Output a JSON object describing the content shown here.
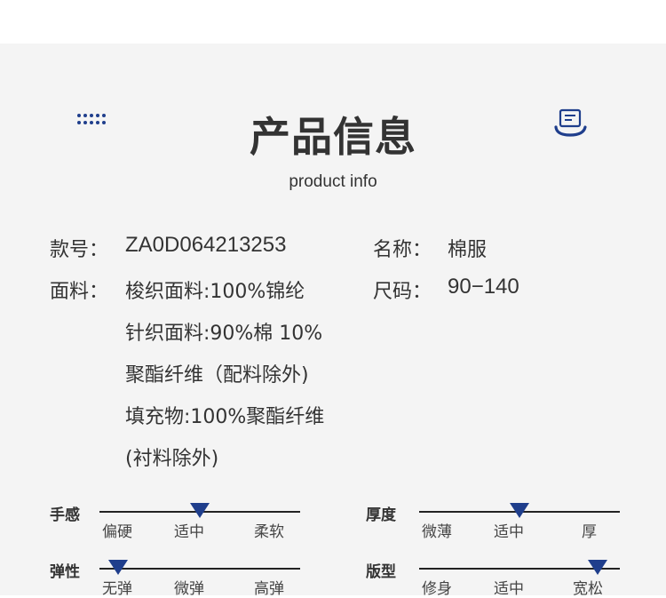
{
  "header": {
    "title": "产品信息",
    "subtitle": "product info",
    "left_icon": "grid-dots-icon",
    "right_icon": "message-icon"
  },
  "colors": {
    "accent": "#1f3e8c",
    "panel_bg": "#f4f4f4",
    "text": "#333333"
  },
  "info": {
    "style_no_label": "款号：",
    "style_no_value": "ZA0D064213253",
    "name_label": "名称：",
    "name_value": "棉服",
    "fabric_label": "面料：",
    "fabric_lines": [
      "梭织面料:100%锦纶",
      "针织面料:90%棉 10%",
      "聚酯纤维（配料除外)",
      "填充物:100%聚酯纤维",
      "(衬料除外)"
    ],
    "size_label": "尺码：",
    "size_value": "90−140"
  },
  "scales": [
    {
      "name": "手感",
      "labels": [
        "偏硬",
        "适中",
        "柔软"
      ],
      "level": 0.5
    },
    {
      "name": "厚度",
      "labels": [
        "微薄",
        "适中",
        "厚"
      ],
      "level": 0.5
    },
    {
      "name": "弹性",
      "labels": [
        "无弹",
        "微弹",
        "高弹"
      ],
      "level": 0.0
    },
    {
      "name": "版型",
      "labels": [
        "修身",
        "适中",
        "宽松"
      ],
      "level": 1.0
    }
  ]
}
